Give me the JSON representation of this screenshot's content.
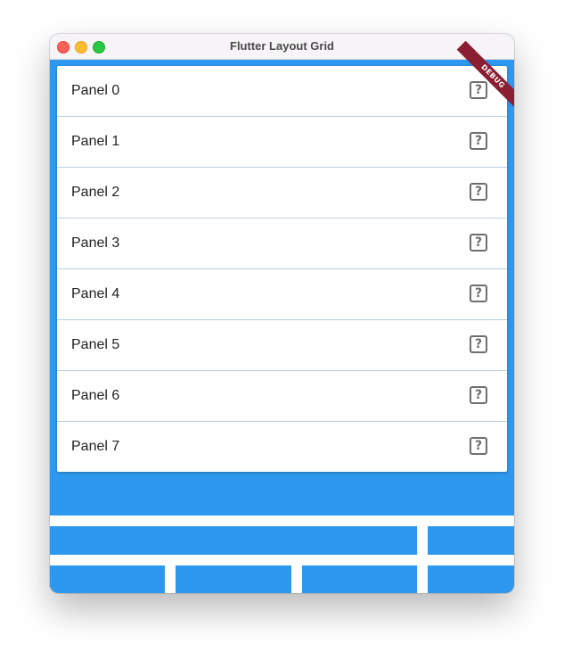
{
  "window": {
    "title": "Flutter Layout Grid"
  },
  "debug_banner": {
    "label": "DEBUG"
  },
  "panels": [
    {
      "label": "Panel 0",
      "icon": "help-icon"
    },
    {
      "label": "Panel 1",
      "icon": "help-icon"
    },
    {
      "label": "Panel 2",
      "icon": "help-icon"
    },
    {
      "label": "Panel 3",
      "icon": "help-icon"
    },
    {
      "label": "Panel 4",
      "icon": "help-icon"
    },
    {
      "label": "Panel 5",
      "icon": "help-icon"
    },
    {
      "label": "Panel 6",
      "icon": "help-icon"
    },
    {
      "label": "Panel 7",
      "icon": "help-icon"
    }
  ],
  "help_icon_glyph": "?",
  "colors": {
    "background": "#2e98ee",
    "panel": "#ffffff",
    "divider": "#b9cfdf",
    "icon": "#6e6e6e",
    "debug_banner": "#8a1e33",
    "grid_lines": "#ffffff"
  }
}
